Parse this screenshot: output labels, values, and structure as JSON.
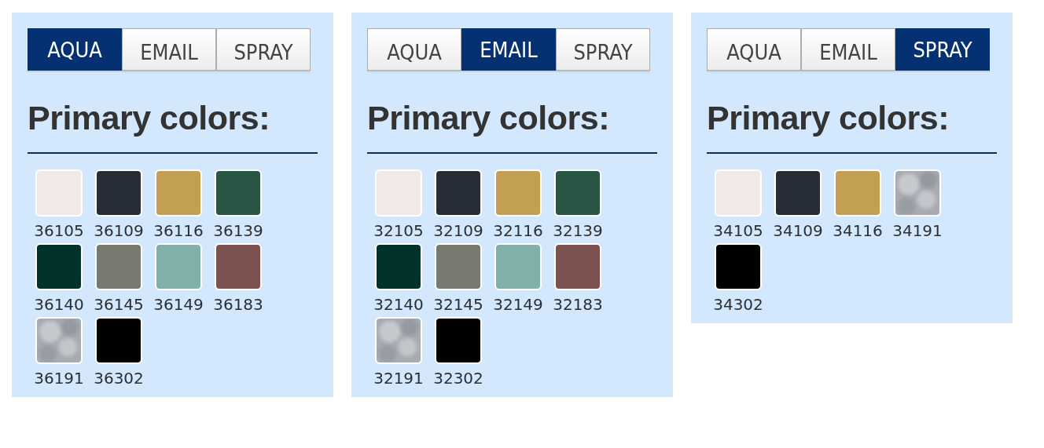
{
  "panels": [
    {
      "tabs": [
        {
          "label": "AQUA",
          "selected": true
        },
        {
          "label": "EMAIL",
          "selected": false
        },
        {
          "label": "SPRAY",
          "selected": false
        }
      ],
      "heading": "Primary colors:",
      "swatches": [
        {
          "code": "36105",
          "color": "#f2e9e6",
          "kind": "solid"
        },
        {
          "code": "36109",
          "color": "#262d36",
          "kind": "solid"
        },
        {
          "code": "36116",
          "color": "#c29f52",
          "kind": "solid"
        },
        {
          "code": "36139",
          "color": "#275645",
          "kind": "solid"
        },
        {
          "code": "36140",
          "color": "#00312b",
          "kind": "solid"
        },
        {
          "code": "36145",
          "color": "#787a70",
          "kind": "solid"
        },
        {
          "code": "36149",
          "color": "#80b0a9",
          "kind": "solid"
        },
        {
          "code": "36183",
          "color": "#7b5250",
          "kind": "solid"
        },
        {
          "code": "36191",
          "color": "#a8acb2",
          "kind": "textured"
        },
        {
          "code": "36302",
          "color": "#000000",
          "kind": "solid"
        }
      ]
    },
    {
      "tabs": [
        {
          "label": "AQUA",
          "selected": false
        },
        {
          "label": "EMAIL",
          "selected": true
        },
        {
          "label": "SPRAY",
          "selected": false
        }
      ],
      "heading": "Primary colors:",
      "swatches": [
        {
          "code": "32105",
          "color": "#f2e9e6",
          "kind": "solid"
        },
        {
          "code": "32109",
          "color": "#262d36",
          "kind": "solid"
        },
        {
          "code": "32116",
          "color": "#c29f52",
          "kind": "solid"
        },
        {
          "code": "32139",
          "color": "#275645",
          "kind": "solid"
        },
        {
          "code": "32140",
          "color": "#00312b",
          "kind": "solid"
        },
        {
          "code": "32145",
          "color": "#787a70",
          "kind": "solid"
        },
        {
          "code": "32149",
          "color": "#80b0a9",
          "kind": "solid"
        },
        {
          "code": "32183",
          "color": "#7b5250",
          "kind": "solid"
        },
        {
          "code": "32191",
          "color": "#a8acb2",
          "kind": "textured"
        },
        {
          "code": "32302",
          "color": "#000000",
          "kind": "solid"
        }
      ]
    },
    {
      "tabs": [
        {
          "label": "AQUA",
          "selected": false
        },
        {
          "label": "EMAIL",
          "selected": false
        },
        {
          "label": "SPRAY",
          "selected": true
        }
      ],
      "heading": "Primary colors:",
      "swatches": [
        {
          "code": "34105",
          "color": "#f2e9e6",
          "kind": "solid"
        },
        {
          "code": "34109",
          "color": "#262d36",
          "kind": "solid"
        },
        {
          "code": "34116",
          "color": "#c29f52",
          "kind": "solid"
        },
        {
          "code": "34191",
          "color": "#a8acb2",
          "kind": "textured"
        },
        {
          "code": "34302",
          "color": "#000000",
          "kind": "solid"
        }
      ]
    }
  ]
}
